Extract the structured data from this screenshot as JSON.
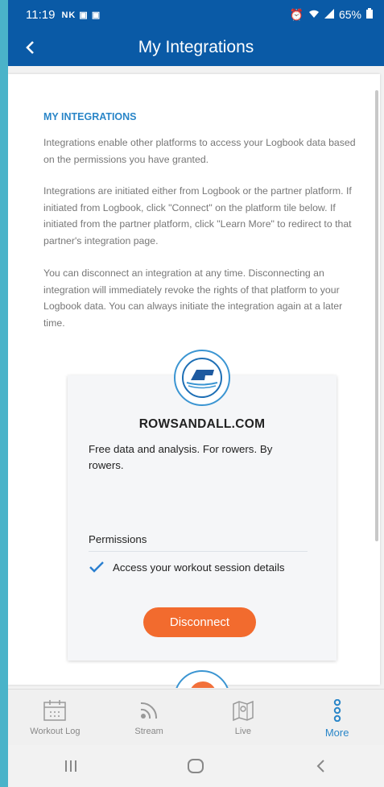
{
  "status_bar": {
    "time": "11:19",
    "notif_icons": "NK ⁢ ⁢",
    "battery": "65%"
  },
  "header": {
    "title": "My Integrations"
  },
  "intro": {
    "heading": "MY INTEGRATIONS",
    "paragraphs": [
      "Integrations enable other platforms to access your Logbook data based on the permissions you have granted.",
      "Integrations are initiated either from Logbook or the partner platform. If initiated from Logbook, click \"Connect\" on the platform tile below. If initiated from the partner platform, click \"Learn More\" to redirect to that partner's integration page.",
      "You can disconnect an integration at any time. Disconnecting an integration will immediately revoke the rights of that platform to your Logbook data. You can always initiate the integration again at a later time."
    ]
  },
  "integration": {
    "name": "ROWSANDALL.COM",
    "description": "Free data and analysis. For rowers. By rowers.",
    "permissions_label": "Permissions",
    "permissions": [
      "Access your workout session details"
    ],
    "button_label": "Disconnect"
  },
  "bottom_nav": {
    "items": [
      {
        "label": "Workout Log",
        "icon": "calendar-icon"
      },
      {
        "label": "Stream",
        "icon": "broadcast-icon"
      },
      {
        "label": "Live",
        "icon": "map-icon"
      },
      {
        "label": "More",
        "icon": "more-icon"
      }
    ],
    "active": "More"
  },
  "colors": {
    "primary": "#0a5aa6",
    "accent": "#2a86c8",
    "button": "#f26b2e",
    "outer": "#4ab3c9"
  }
}
